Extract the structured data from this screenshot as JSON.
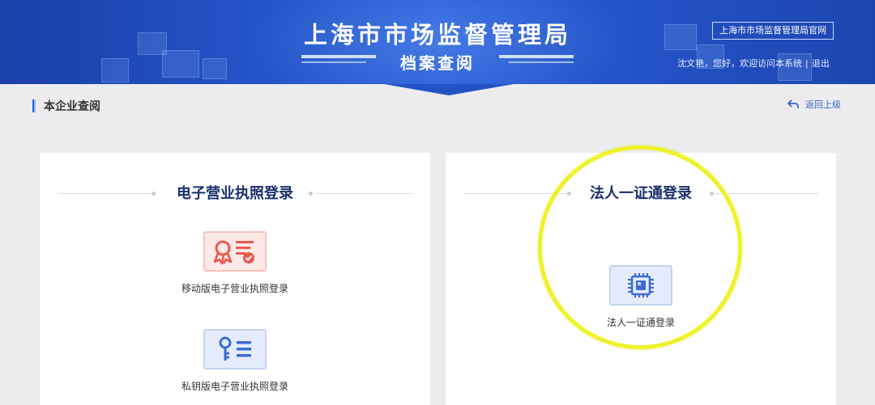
{
  "header": {
    "site_title": "上海市市场监督管理局",
    "sub_title": "档案查阅",
    "official_link": "上海市市场监督管理局官网",
    "welcome": {
      "greeting": "沈文艳，您好，欢迎访问本系统",
      "separator": "|",
      "logout": "退出"
    }
  },
  "page": {
    "title": "本企业查阅",
    "back_label": "返回上级"
  },
  "left_panel": {
    "heading": "电子营业执照登录",
    "options": [
      {
        "label": "移动版电子营业执照登录",
        "icon": "certificate-icon"
      },
      {
        "label": "私钥版电子营业执照登录",
        "icon": "key-icon"
      }
    ]
  },
  "right_panel": {
    "heading": "法人一证通登录",
    "options": [
      {
        "label": "法人一证通登录",
        "icon": "chip-icon"
      }
    ]
  },
  "colors": {
    "header_blue": "#2454c8",
    "heading_navy": "#1a2f6e",
    "accent_red": "#e85b4f",
    "accent_blue": "#3d6bd6",
    "highlight_yellow": "#eef22a"
  }
}
